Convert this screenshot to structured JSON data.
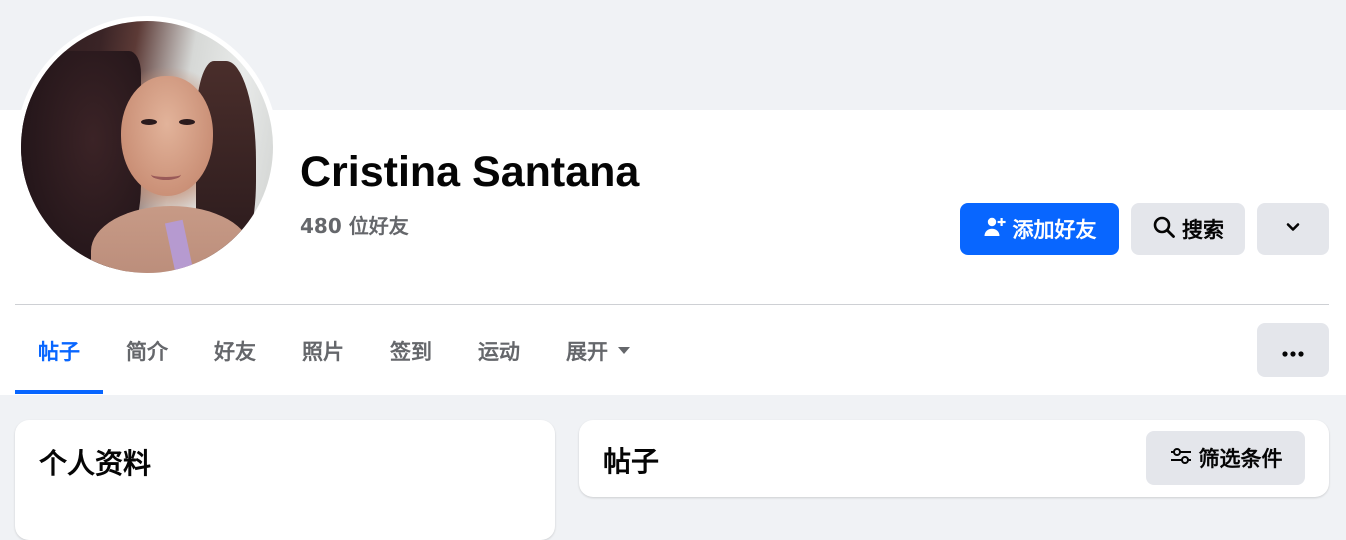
{
  "profile": {
    "name": "Cristina Santana",
    "friends_count": "480 位好友"
  },
  "actions": {
    "add_friend_label": "添加好友",
    "add_friend_icon": "person-add-icon",
    "search_label": "搜索",
    "search_icon": "search-icon",
    "more_icon": "chevron-down-icon"
  },
  "tabs": [
    {
      "label": "帖子",
      "active": true
    },
    {
      "label": "简介",
      "active": false
    },
    {
      "label": "好友",
      "active": false
    },
    {
      "label": "照片",
      "active": false
    },
    {
      "label": "签到",
      "active": false
    },
    {
      "label": "运动",
      "active": false
    },
    {
      "label": "展开",
      "active": false
    }
  ],
  "tab_more_icon": "ellipsis-icon",
  "intro_card": {
    "title": "个人资料"
  },
  "posts_card": {
    "title": "帖子",
    "filter_label": "筛选条件",
    "filter_icon": "sliders-icon"
  },
  "colors": {
    "accent": "#0866ff",
    "background": "#f0f2f5",
    "secondary_button": "#e4e6eb",
    "muted_text": "#65676b"
  }
}
